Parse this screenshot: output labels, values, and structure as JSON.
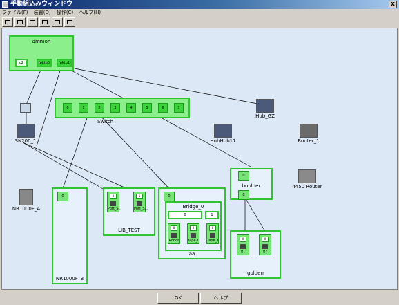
{
  "window": {
    "title": "手動組込みウィンドウ",
    "close": "x"
  },
  "menu": [
    "ファイル(F)",
    "装置(D)",
    "操作(C)",
    "ヘルプ(H)"
  ],
  "toolbar": {
    "count": 6
  },
  "groups": {
    "ammon": {
      "label": "ammon",
      "ports": [
        "c2",
        "fpktp0",
        "fpktp1"
      ]
    },
    "switch": {
      "label": "Switch",
      "ports": [
        "0",
        "1",
        "2",
        "3",
        "4",
        "5",
        "6",
        "7"
      ]
    },
    "boulder": {
      "label": "boulder",
      "ports": [
        "0",
        "0"
      ]
    },
    "bridge": {
      "label": "Bridge_0",
      "ports": [
        "0",
        "1"
      ],
      "subs": [
        "Robot",
        "Tape_0",
        "Tape_1"
      ],
      "subtops": [
        "0",
        "0",
        "0"
      ]
    },
    "aa": {
      "label": "aa",
      "tag": "0"
    },
    "libtest": {
      "label": "LIB_TEST",
      "subs": [
        "Port_S...",
        "Port_S..."
      ],
      "subtops": [
        "0",
        "1"
      ]
    },
    "nr1000fb": {
      "label": "NR1000F_B",
      "tag": "0"
    },
    "golden": {
      "label": "golden",
      "subs": [
        "g1",
        "g2"
      ],
      "subtops": [
        "0",
        "0"
      ]
    }
  },
  "devices": {
    "hubgz": "Hub_GZ",
    "hubhub11": "HubHub11",
    "router1": "Router_1",
    "sn200": "SN200_1",
    "router4450": "4450 Router",
    "nr1000fa": "NR1000F_A"
  },
  "buttons": {
    "ok": "OK",
    "help": "ヘルプ"
  }
}
